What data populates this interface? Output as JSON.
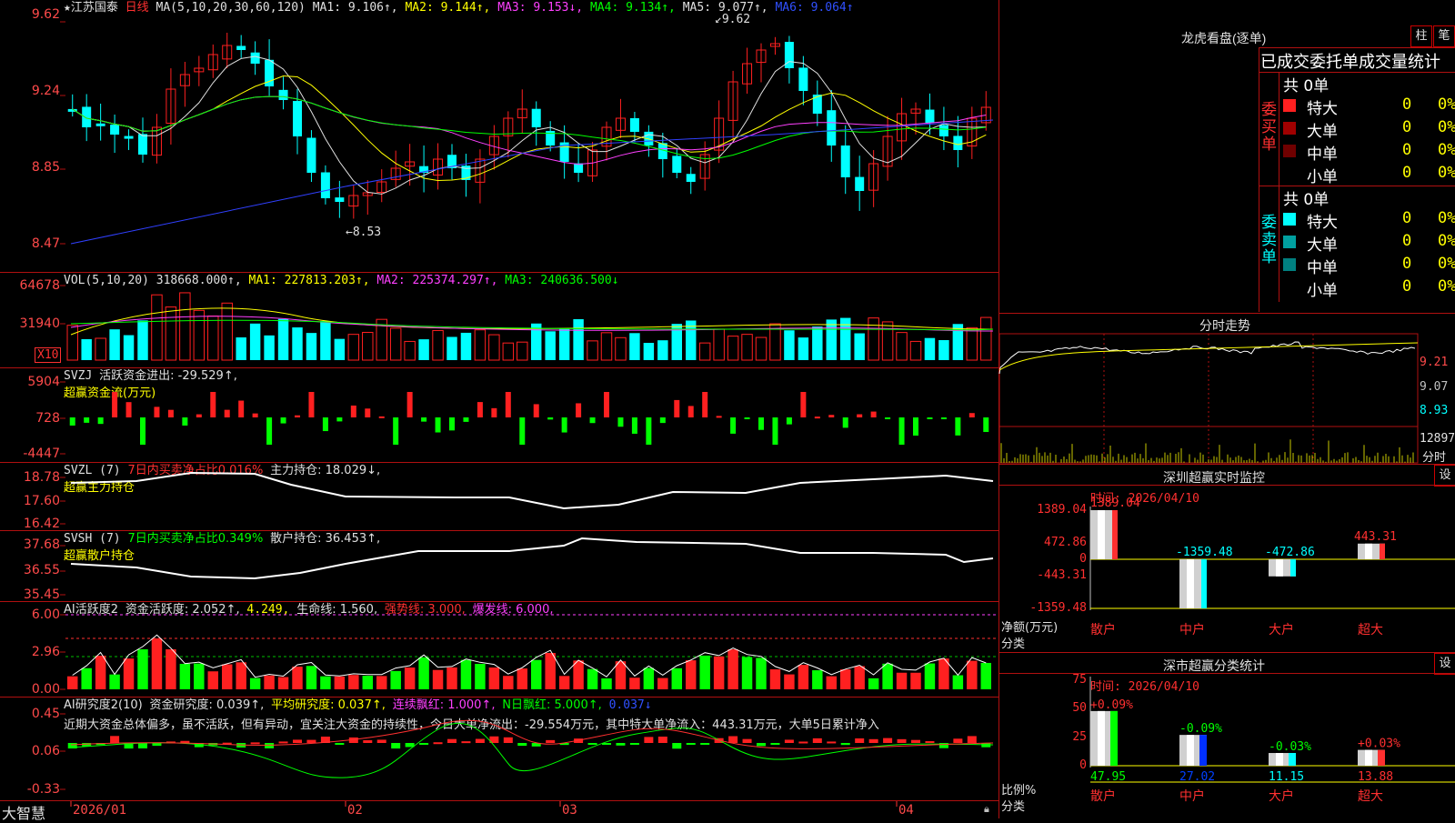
{
  "colors": {
    "up": "#ff2020",
    "down": "#00ffff",
    "grid": "#b01010",
    "ma1": "#e0e0e0",
    "ma2": "#ffff00",
    "ma3": "#ff40ff",
    "ma4": "#00ff00",
    "ma5": "#e0e0e0",
    "ma6": "#3040ff"
  },
  "main": {
    "star": "★",
    "stock_name": "江苏国泰",
    "period": "日线",
    "ma_label": "MA(5,10,20,30,60,120)",
    "ma1": "MA1: 9.106↑,",
    "ma2": "MA2: 9.144↑,",
    "ma3": "MA3: 9.153↓,",
    "ma4": "MA4: 9.134↑,",
    "ma5": "MA5: 9.077↑,",
    "ma6": "MA6: 9.064↑",
    "y_ticks": [
      "9.62",
      "9.24",
      "8.85",
      "8.47"
    ],
    "high_marker": "9.62",
    "low_marker": "8.53"
  },
  "vol": {
    "label": "VOL(5,10,20)",
    "value": "318668.000↑,",
    "ma1": "MA1: 227813.203↑,",
    "ma2": "MA2: 225374.297↑,",
    "ma3": "MA3: 240636.500↓",
    "y_ticks": [
      "64678",
      "31940"
    ],
    "unit": "X10"
  },
  "svzj": {
    "label": "SVZJ",
    "desc": "活跃资金进出: -29.529↑,",
    "sub": "超赢资金流(万元)",
    "y_ticks": [
      "5904",
      "728",
      "-4447"
    ]
  },
  "svzl": {
    "label": "SVZL (7)",
    "desc1": "7日内买卖净占比0.016%",
    "desc2": "主力持仓: 18.029↓,",
    "sub": "超赢主力持仓",
    "y_ticks": [
      "18.78",
      "17.60",
      "16.42"
    ]
  },
  "svsh": {
    "label": "SVSH (7)",
    "desc1": "7日内买卖净占比0.349%",
    "desc2": "散户持仓: 36.453↑,",
    "sub": "超赢散户持仓",
    "y_ticks": [
      "37.68",
      "36.55",
      "35.45"
    ]
  },
  "ai1": {
    "label": "AI活跃度2",
    "d1": "资金活跃度: 2.052↑,",
    "d2": "4.249,",
    "d3": "生命线: 1.560,",
    "d4": "强势线: 3.000,",
    "d5": "爆发线: 6.000,",
    "y_ticks": [
      "6.00",
      "2.96",
      "0.00"
    ]
  },
  "ai2": {
    "label": "AI研究度2(10)",
    "d1": "资金研究度: 0.039↑,",
    "d2": "平均研究度: 0.037↑,",
    "d3": "连续飘红: 1.000↑,",
    "d4": "N日飘红: 5.000↑,",
    "d5": "0.037↓",
    "comment": "近期大资金总体偏多，虽不活跃，但有异动，宜关注大资金的持续性，今日大单净流出：-29.554万元，其中特大单净流入：443.31万元，大单5日累计净入",
    "y_ticks": [
      "0.45",
      "0.06",
      "-0.33"
    ]
  },
  "xaxis": {
    "brand": "大智慧",
    "labels": [
      "2026/01",
      "02",
      "03",
      "04"
    ]
  },
  "dragon": {
    "title": "龙虎看盘(逐单)",
    "btn1": "柱",
    "btn2": "笔",
    "tabs": [
      "已成交委托单",
      "成交量统计"
    ],
    "buy": {
      "side": "委买单",
      "total": "共 0单",
      "rows": [
        {
          "name": "特大",
          "v": "0",
          "p": "0%",
          "c": "#ff2020"
        },
        {
          "name": "大单",
          "v": "0",
          "p": "0%",
          "c": "#a00000"
        },
        {
          "name": "中单",
          "v": "0",
          "p": "0%",
          "c": "#700000"
        },
        {
          "name": "小单",
          "v": "0",
          "p": "0%",
          "c": ""
        }
      ]
    },
    "sell": {
      "side": "委卖单",
      "total": "共 0单",
      "rows": [
        {
          "name": "特大",
          "v": "0",
          "p": "0%",
          "c": "#00ffff"
        },
        {
          "name": "大单",
          "v": "0",
          "p": "0%",
          "c": "#00a0a0"
        },
        {
          "name": "中单",
          "v": "0",
          "p": "0%",
          "c": "#008080"
        },
        {
          "name": "小单",
          "v": "0",
          "p": "0%",
          "c": ""
        }
      ]
    }
  },
  "intraday": {
    "title": "分时走势",
    "y_ticks": [
      "9.21",
      "9.07",
      "8.93"
    ],
    "vol_tick": "12897",
    "vol_label": "分时"
  },
  "monitor": {
    "title": "深圳超赢实时监控",
    "btn": "设",
    "time": "时间: 2026/04/10",
    "y_ticks": [
      "1389.04",
      "472.86",
      "0",
      "-443.31",
      "-1359.48"
    ],
    "ylabel1": "净额(万元)",
    "ylabel2": "分类",
    "chart_data": {
      "type": "bar",
      "categories": [
        "散户",
        "中户",
        "大户",
        "超大"
      ],
      "values": [
        1389.04,
        -1359.48,
        -472.86,
        443.31
      ],
      "value_labels": [
        "1389.04",
        "-1359.48",
        "-472.86",
        "443.31"
      ],
      "ylim": [
        -1359.48,
        1389.04
      ],
      "ylabel": "净额(万元)",
      "xlabel": "分类"
    }
  },
  "classify": {
    "title": "深市超赢分类统计",
    "btn": "设",
    "time": "时间: 2026/04/10",
    "y_ticks": [
      "75",
      "50",
      "25",
      "0"
    ],
    "ylabel1": "比例%",
    "ylabel2": "分类",
    "chart_data": {
      "type": "bar",
      "categories": [
        "散户",
        "中户",
        "大户",
        "超大"
      ],
      "values": [
        47.95,
        27.02,
        11.15,
        13.88
      ],
      "value_labels": [
        "47.95",
        "27.02",
        "11.15",
        "13.88"
      ],
      "changes": [
        "+0.09%",
        "-0.09%",
        "-0.03%",
        "+0.03%"
      ],
      "ylim": [
        0,
        75
      ],
      "ylabel": "比例%",
      "xlabel": "分类"
    }
  }
}
